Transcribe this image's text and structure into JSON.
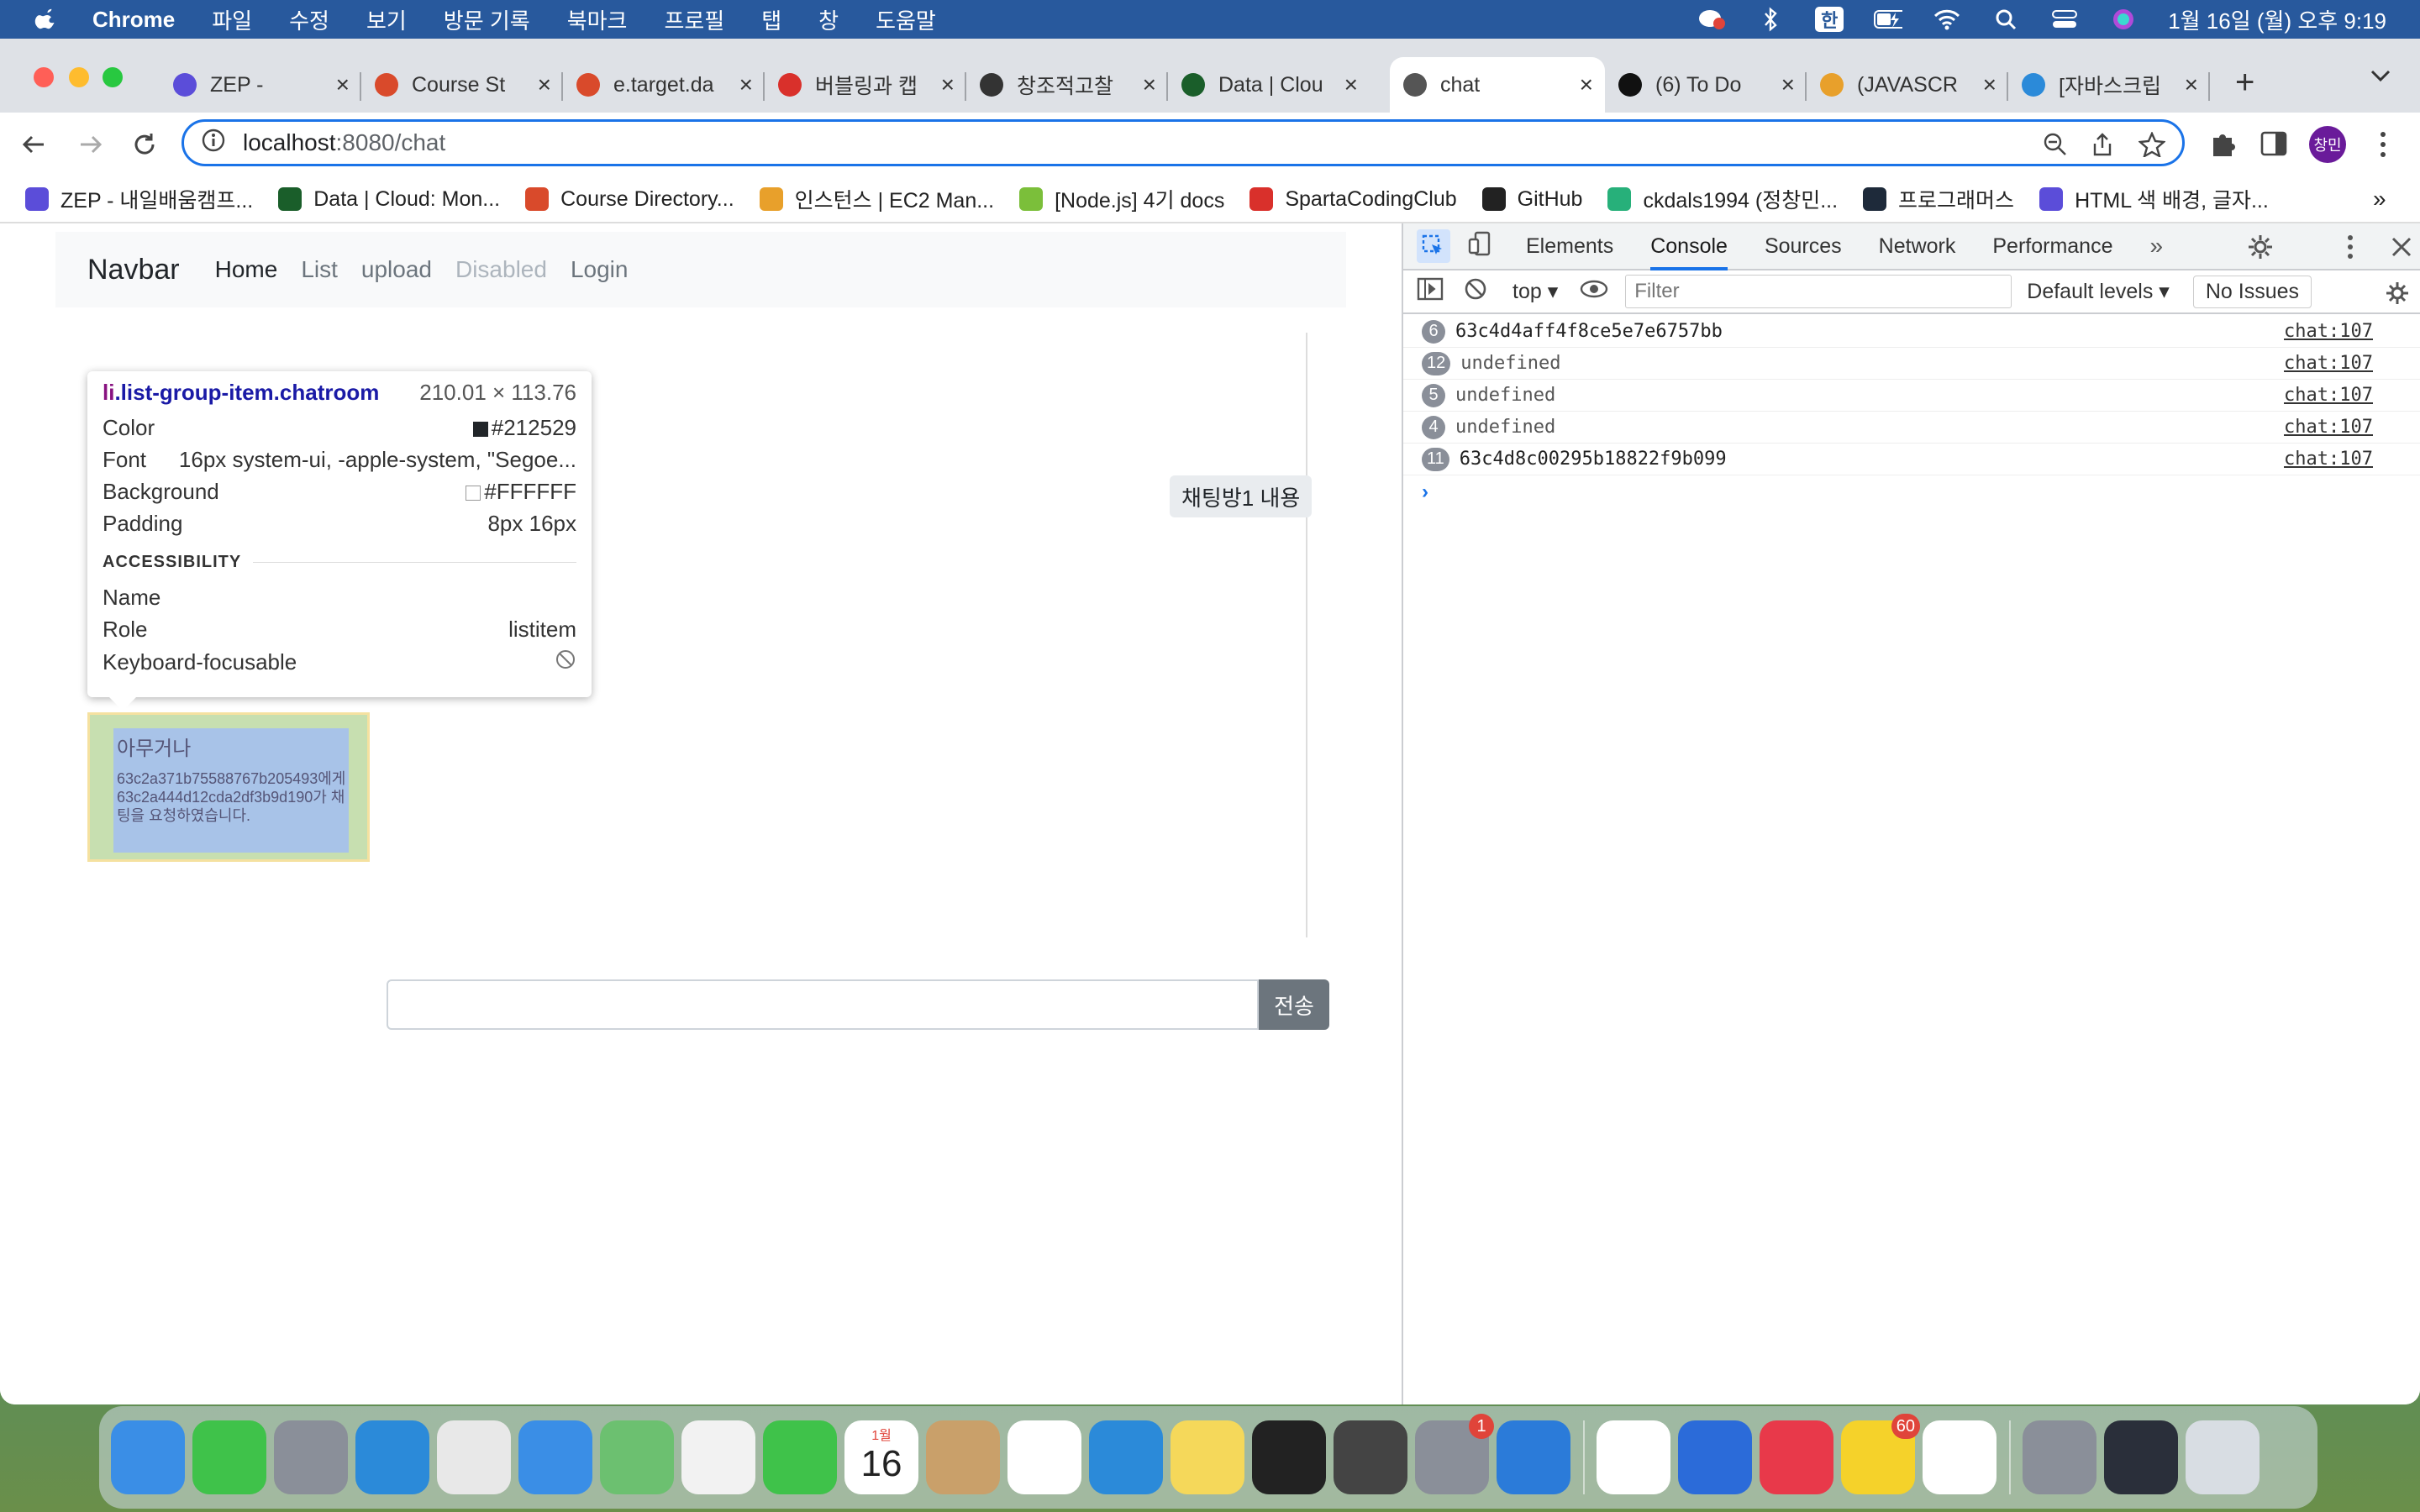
{
  "menubar": {
    "app_name": "Chrome",
    "items": [
      "파일",
      "수정",
      "보기",
      "방문 기록",
      "북마크",
      "프로필",
      "탭",
      "창",
      "도움말"
    ],
    "input_method": "한",
    "clock": "1월 16일 (월) 오후 9:19"
  },
  "tabs": [
    {
      "title": "ZEP - ",
      "icon": "zep-icon",
      "color": "#5b4dd9"
    },
    {
      "title": "Course St",
      "icon": "apple-icon",
      "color": "#d94a2b"
    },
    {
      "title": "e.target.da",
      "icon": "apple-icon",
      "color": "#d94a2b"
    },
    {
      "title": "버블링과 캡",
      "icon": "figure-icon",
      "color": "#d9302b"
    },
    {
      "title": "창조적고찰",
      "icon": "dots-icon",
      "color": "#333333"
    },
    {
      "title": "Data | Clou",
      "icon": "mongodb-icon",
      "color": "#1a5e2a"
    },
    {
      "title": "chat",
      "icon": "globe-icon",
      "color": "#555555",
      "active": true
    },
    {
      "title": "(6) To Do ",
      "icon": "notion-icon",
      "color": "#111111"
    },
    {
      "title": "(JAVASCR",
      "icon": "braces-icon",
      "color": "#e8a02b"
    },
    {
      "title": "[자바스크립",
      "icon": "dale-icon",
      "color": "#2b8ad9"
    }
  ],
  "toolbar": {
    "url_host": "localhost",
    "url_path": ":8080/chat",
    "profile_label": "창민"
  },
  "bookmarks": [
    {
      "label": "ZEP - 내일배움캠프...",
      "color": "#5b4dd9"
    },
    {
      "label": "Data | Cloud: Mon...",
      "color": "#1a5e2a"
    },
    {
      "label": "Course Directory...",
      "color": "#d94a2b"
    },
    {
      "label": "인스턴스 | EC2 Man...",
      "color": "#e8a02b"
    },
    {
      "label": "[Node.js] 4기 docs",
      "color": "#7bbf3a"
    },
    {
      "label": "SpartaCodingClub",
      "color": "#d9302b"
    },
    {
      "label": "GitHub",
      "color": "#222222"
    },
    {
      "label": "ckdals1994 (정창민...",
      "color": "#27b07a"
    },
    {
      "label": "프로그래머스",
      "color": "#1e2a3a"
    },
    {
      "label": "HTML 색 배경, 글자...",
      "color": "#5b4dd9"
    }
  ],
  "page": {
    "navbar": {
      "brand": "Navbar",
      "links": [
        "Home",
        "List",
        "upload",
        "Disabled",
        "Login"
      ]
    },
    "message": "채팅방1 내용",
    "send_label": "전송",
    "chatroom": {
      "title": "아무거나",
      "body": "63c2a371b75588767b205493에게 63c2a444d12cda2df3b9d190가 채팅을 요청하였습니다."
    }
  },
  "inspector_tooltip": {
    "selector_tag": "li",
    "selector_class": ".list-group-item.chatroom",
    "size": "210.01 × 113.76",
    "color_label": "Color",
    "color_value": "#212529",
    "font_label": "Font",
    "font_value": "16px system-ui, -apple-system, \"Segoe...",
    "background_label": "Background",
    "background_value": "#FFFFFF",
    "padding_label": "Padding",
    "padding_value": "8px 16px",
    "accessibility_heading": "ACCESSIBILITY",
    "name_label": "Name",
    "role_label": "Role",
    "role_value": "listitem",
    "focusable_label": "Keyboard-focusable"
  },
  "devtools": {
    "tabs": [
      "Elements",
      "Console",
      "Sources",
      "Network",
      "Performance"
    ],
    "active_tab": "Console",
    "context": "top",
    "filter_placeholder": "Filter",
    "levels": "Default levels",
    "issues": "No Issues",
    "logs": [
      {
        "count": "6",
        "text": "63c4d4aff4f8ce5e7e6757bb",
        "source": "chat:107",
        "undefined": false
      },
      {
        "count": "12",
        "text": "undefined",
        "source": "chat:107",
        "undefined": true
      },
      {
        "count": "5",
        "text": "undefined",
        "source": "chat:107",
        "undefined": true
      },
      {
        "count": "4",
        "text": "undefined",
        "source": "chat:107",
        "undefined": true
      },
      {
        "count": "11",
        "text": "63c4d8c00295b18822f9b099",
        "source": "chat:107",
        "undefined": false
      }
    ]
  },
  "dock": {
    "apps": [
      {
        "name": "finder-icon",
        "color": "#3a8ee6"
      },
      {
        "name": "messages-icon",
        "color": "#3fc24a"
      },
      {
        "name": "launchpad-icon",
        "color": "#8a8f99"
      },
      {
        "name": "safari-icon",
        "color": "#2b8ad9"
      },
      {
        "name": "chrome-icon",
        "color": "#e8e8e8"
      },
      {
        "name": "mail-icon",
        "color": "#3a8ee6"
      },
      {
        "name": "maps-icon",
        "color": "#6cc070"
      },
      {
        "name": "photos-icon",
        "color": "#f2f2f2"
      },
      {
        "name": "facetime-icon",
        "color": "#3fc24a"
      },
      {
        "name": "calendar-icon",
        "color": "#ffffff",
        "label_month": "1월",
        "label_day": "16"
      },
      {
        "name": "contacts-icon",
        "color": "#c9a06a"
      },
      {
        "name": "reminders-icon",
        "color": "#ffffff"
      },
      {
        "name": "appstore-icon",
        "color": "#2b8ad9"
      },
      {
        "name": "notes-icon",
        "color": "#f5d85a"
      },
      {
        "name": "terminal-icon",
        "color": "#222222"
      },
      {
        "name": "tableplus-icon",
        "color": "#444444"
      },
      {
        "name": "system-settings-icon",
        "color": "#8a8f99",
        "badge": "1"
      },
      {
        "name": "vscode-icon",
        "color": "#2b7bd9"
      },
      {
        "name": "pen-icon",
        "color": "#ffffff"
      },
      {
        "name": "pin-icon",
        "color": "#2b6bd9"
      },
      {
        "name": "music-icon",
        "color": "#e8394a"
      },
      {
        "name": "kakaotalk-icon",
        "color": "#f5d22a",
        "badge": "60"
      },
      {
        "name": "slack-icon",
        "color": "#ffffff"
      },
      {
        "name": "preview-icon",
        "color": "#8a8f99"
      },
      {
        "name": "window-icon",
        "color": "#2a2f3a"
      },
      {
        "name": "trash-icon",
        "color": "#d8dde3"
      }
    ]
  }
}
